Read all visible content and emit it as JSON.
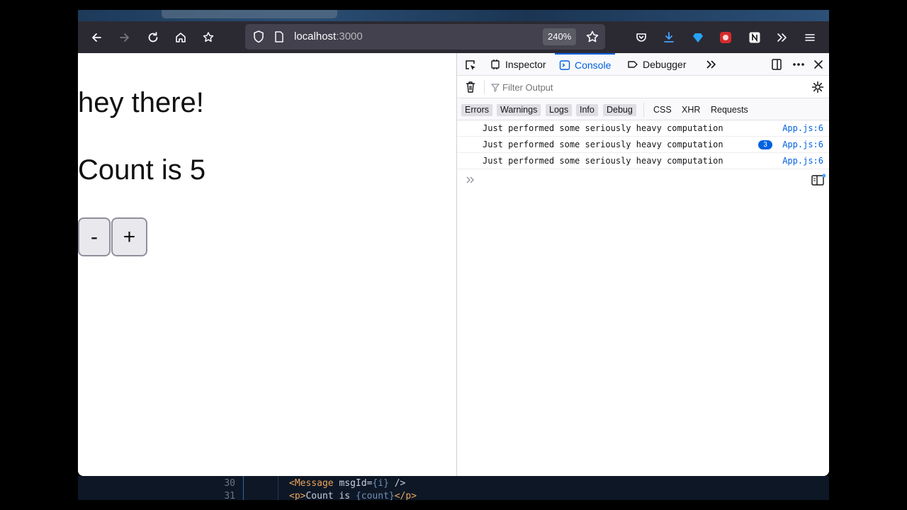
{
  "browser": {
    "url_host": "localhost",
    "url_port": ":3000",
    "zoom": "240%"
  },
  "page": {
    "greeting": "hey there!",
    "count_text": "Count is 5",
    "minus_label": "-",
    "plus_label": "+"
  },
  "devtools": {
    "tabs": [
      {
        "label": "Inspector"
      },
      {
        "label": "Console"
      },
      {
        "label": "Debugger"
      }
    ],
    "filter_placeholder": "Filter Output",
    "levels": [
      "Errors",
      "Warnings",
      "Logs",
      "Info",
      "Debug"
    ],
    "categories": [
      "CSS",
      "XHR",
      "Requests"
    ],
    "messages": [
      {
        "text": "Just performed some seriously heavy computation",
        "location": "App.js:6",
        "repeat": ""
      },
      {
        "text": "Just performed some seriously heavy computation",
        "location": "App.js:6",
        "repeat": "3"
      },
      {
        "text": "Just performed some seriously heavy computation",
        "location": "App.js:6",
        "repeat": ""
      }
    ]
  },
  "editor": {
    "lines": [
      {
        "number": "30",
        "tag_open": "<Message",
        "attr": " msgId=",
        "expr": "{i}",
        "tag_close": " />"
      },
      {
        "number": "31",
        "tag_open": "<p>",
        "attr": "Count is ",
        "expr": "{count}",
        "tag_close": "</p>"
      }
    ]
  },
  "colors": {
    "accent": "#0061e0",
    "toolbar": "#2b2a33",
    "urlbar": "#42414d"
  }
}
